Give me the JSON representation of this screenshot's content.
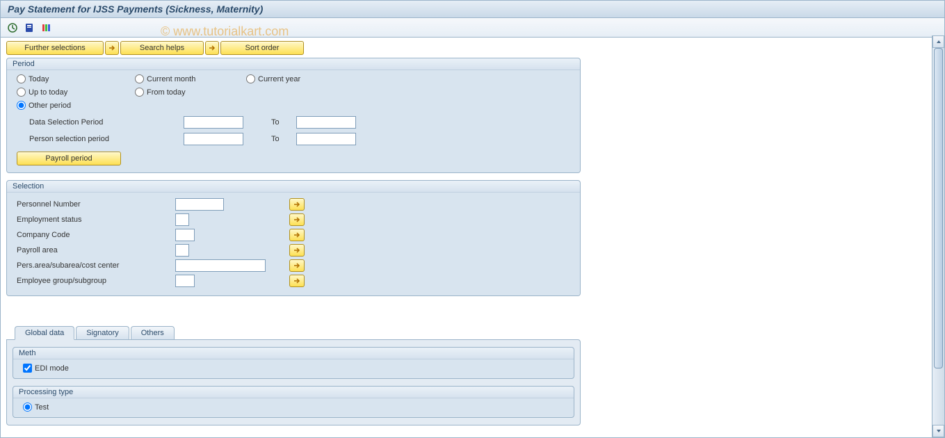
{
  "title": "Pay Statement for IJSS Payments (Sickness, Maternity)",
  "watermark": "© www.tutorialkart.com",
  "top_buttons": {
    "further_selections": "Further selections",
    "search_helps": "Search helps",
    "sort_order": "Sort order"
  },
  "period": {
    "title": "Period",
    "radios": {
      "today": "Today",
      "current_month": "Current month",
      "current_year": "Current year",
      "up_to_today": "Up to today",
      "from_today": "From today",
      "other_period": "Other period"
    },
    "selected": "other_period",
    "data_selection_label": "Data Selection Period",
    "person_selection_label": "Person selection period",
    "to_label": "To",
    "payroll_period_btn": "Payroll period",
    "values": {
      "data_from": "",
      "data_to": "",
      "person_from": "",
      "person_to": ""
    }
  },
  "selection": {
    "title": "Selection",
    "rows": [
      {
        "label": "Personnel Number",
        "width": "w70",
        "value": ""
      },
      {
        "label": "Employment status",
        "width": "w20",
        "value": ""
      },
      {
        "label": "Company Code",
        "width": "w28",
        "value": ""
      },
      {
        "label": "Payroll area",
        "width": "w20",
        "value": ""
      },
      {
        "label": "Pers.area/subarea/cost center",
        "width": "w130",
        "value": ""
      },
      {
        "label": "Employee group/subgroup",
        "width": "w28",
        "value": ""
      }
    ]
  },
  "tabs": {
    "items": [
      "Global data",
      "Signatory",
      "Others"
    ],
    "active": 0
  },
  "meth": {
    "title": "Meth",
    "edi_label": "EDI mode",
    "edi_checked": true
  },
  "processing": {
    "title": "Processing type",
    "test_label": "Test",
    "test_selected": true
  }
}
